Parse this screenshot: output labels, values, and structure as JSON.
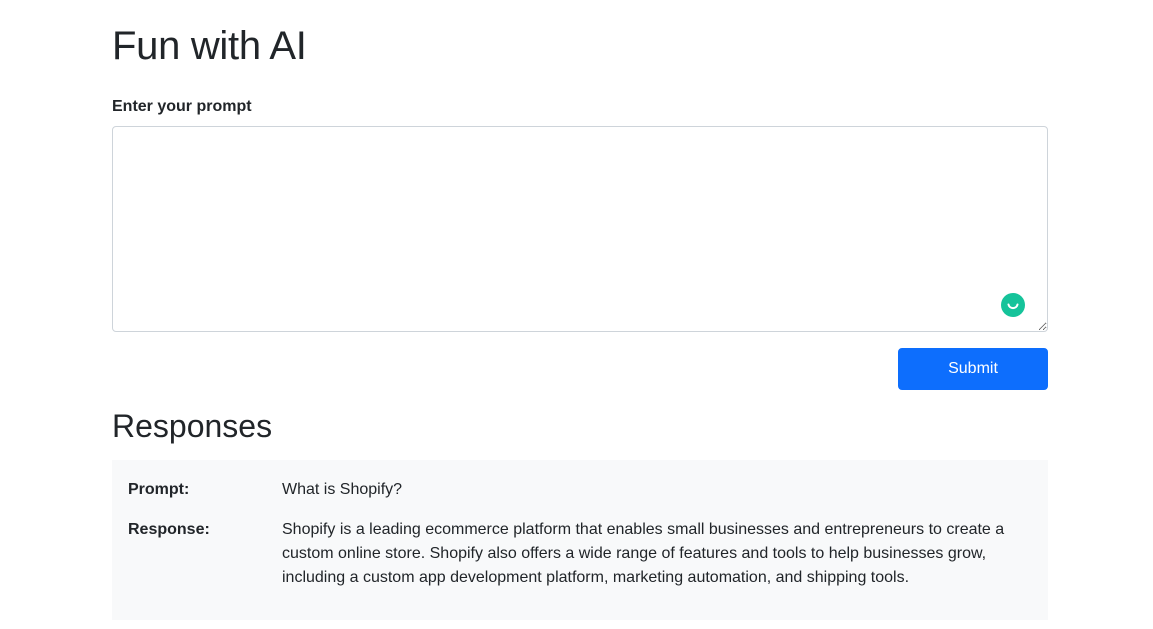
{
  "page": {
    "title": "Fun with AI"
  },
  "form": {
    "prompt_label": "Enter your prompt",
    "prompt_value": "",
    "submit_label": "Submit"
  },
  "responses": {
    "heading": "Responses",
    "items": [
      {
        "prompt_label": "Prompt:",
        "prompt_text": "What is Shopify?",
        "response_label": "Response:",
        "response_text": "Shopify is a leading ecommerce platform that enables small businesses and entrepreneurs to create a custom online store. Shopify also offers a wide range of features and tools to help businesses grow, including a custom app development platform, marketing automation, and shipping tools."
      }
    ]
  },
  "icons": {
    "textarea_assistant": "grammarly-icon"
  },
  "colors": {
    "primary": "#0d6efd",
    "card_background": "#f8f9fa",
    "assistant_icon": "#15c39a",
    "text": "#212529"
  }
}
